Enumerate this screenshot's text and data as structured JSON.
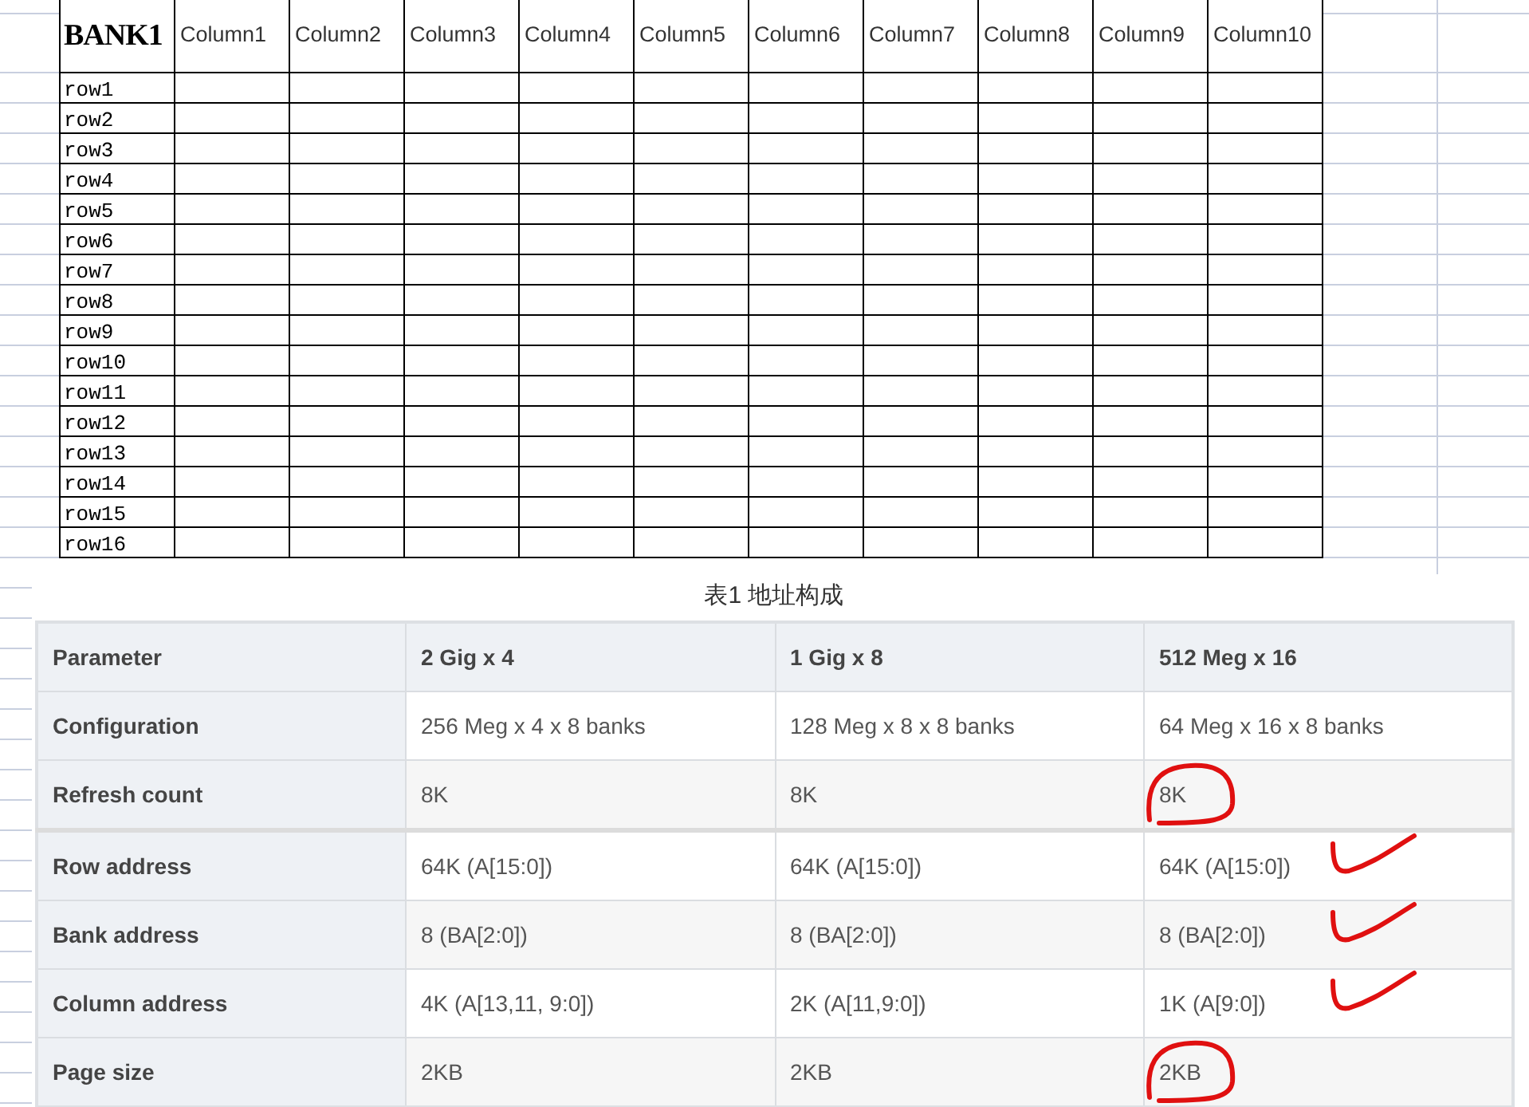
{
  "sheet": {
    "corner": "BANK1",
    "columns": [
      "Column1",
      "Column2",
      "Column3",
      "Column4",
      "Column5",
      "Column6",
      "Column7",
      "Column8",
      "Column9",
      "Column10"
    ],
    "rows": [
      "row1",
      "row2",
      "row3",
      "row4",
      "row5",
      "row6",
      "row7",
      "row8",
      "row9",
      "row10",
      "row11",
      "row12",
      "row13",
      "row14",
      "row15",
      "row16"
    ]
  },
  "caption": "表1 地址构成",
  "table": {
    "columns": [
      "Parameter",
      "2 Gig x 4",
      "1 Gig x 8",
      "512 Meg x 16"
    ],
    "rows": [
      {
        "cells": [
          {
            "kind": "label",
            "text": "Configuration"
          },
          {
            "kind": "value",
            "text": "256 Meg x 4 x 8 banks"
          },
          {
            "kind": "value",
            "text": "128 Meg x 8 x 8 banks"
          },
          {
            "kind": "value",
            "text": "64 Meg x 16 x 8 banks"
          }
        ]
      },
      {
        "cells": [
          {
            "kind": "label",
            "text": "Refresh count"
          },
          {
            "kind": "value",
            "text": "8K"
          },
          {
            "kind": "value",
            "text": "8K"
          },
          {
            "kind": "circled",
            "text": "8K"
          }
        ]
      },
      {
        "cells": [
          {
            "kind": "label",
            "text": "Row address"
          },
          {
            "kind": "value",
            "text": "64K (A[15:0])"
          },
          {
            "kind": "value",
            "text": "64K (A[15:0])"
          },
          {
            "kind": "ticked",
            "text": "64K (A[15:0])"
          }
        ]
      },
      {
        "cells": [
          {
            "kind": "label",
            "text": "Bank address"
          },
          {
            "kind": "value",
            "text": "8 (BA[2:0])"
          },
          {
            "kind": "value",
            "text": "8 (BA[2:0])"
          },
          {
            "kind": "ticked",
            "text": "8 (BA[2:0])"
          }
        ]
      },
      {
        "cells": [
          {
            "kind": "label",
            "text": "Column address"
          },
          {
            "kind": "value",
            "text": "4K (A[13,11, 9:0])"
          },
          {
            "kind": "value",
            "text": "2K (A[11,9:0])"
          },
          {
            "kind": "ticked",
            "text": "1K (A[9:0])"
          }
        ]
      },
      {
        "cells": [
          {
            "kind": "label",
            "text": "Page size"
          },
          {
            "kind": "value",
            "text": "2KB"
          },
          {
            "kind": "value",
            "text": "2KB"
          },
          {
            "kind": "circled",
            "text": "2KB"
          }
        ]
      }
    ]
  }
}
